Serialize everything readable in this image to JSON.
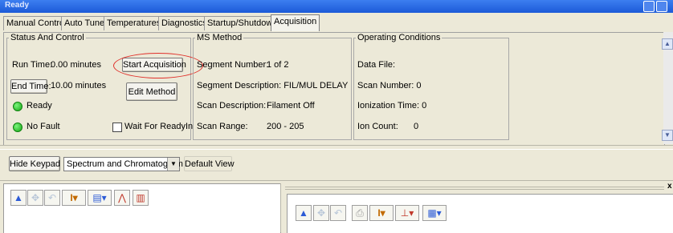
{
  "window": {
    "title": "Ready"
  },
  "tabs": [
    "Manual Control",
    "Auto Tune",
    "Temperatures",
    "Diagnostics",
    "Startup/Shutdown",
    "Acquisition"
  ],
  "status": {
    "legend": "Status And Control",
    "run_time_label": "Run Time:",
    "run_time_value": "0.00 minutes",
    "start_button": "Start Acquisition",
    "end_time_button": "End Time:",
    "end_time_value": "10.00 minutes",
    "edit_method_button": "Edit Method",
    "ready_text": "Ready",
    "no_fault_text": "No Fault",
    "wait_checkbox_label": "Wait For ReadyIn"
  },
  "ms_method": {
    "legend": "MS Method",
    "segment_number_label": "Segment Number:",
    "segment_number_value": "1 of 2",
    "segment_description": "Segment Description: FIL/MUL DELAY",
    "scan_description_label": "Scan Description:",
    "scan_description_value": "Filament Off",
    "scan_range_label": "Scan Range:",
    "scan_range_value": "200 - 205"
  },
  "operating": {
    "legend": "Operating Conditions",
    "data_file_label": "Data File:",
    "scan_number": "Scan Number: 0",
    "ionization_time": "Ionization Time: 0",
    "ion_count_label": "Ion Count:",
    "ion_count_value": "0"
  },
  "toolbar": {
    "hide_keypad": "Hide Keypad",
    "view_select": "Spectrum and Chromatogram",
    "default_view": "Default View"
  },
  "right_pane": {
    "close_glyph": "x"
  },
  "colors": {
    "status_green": "#16a816",
    "highlight_circle": "#e0302a",
    "titlebar": "#2a66e0"
  }
}
